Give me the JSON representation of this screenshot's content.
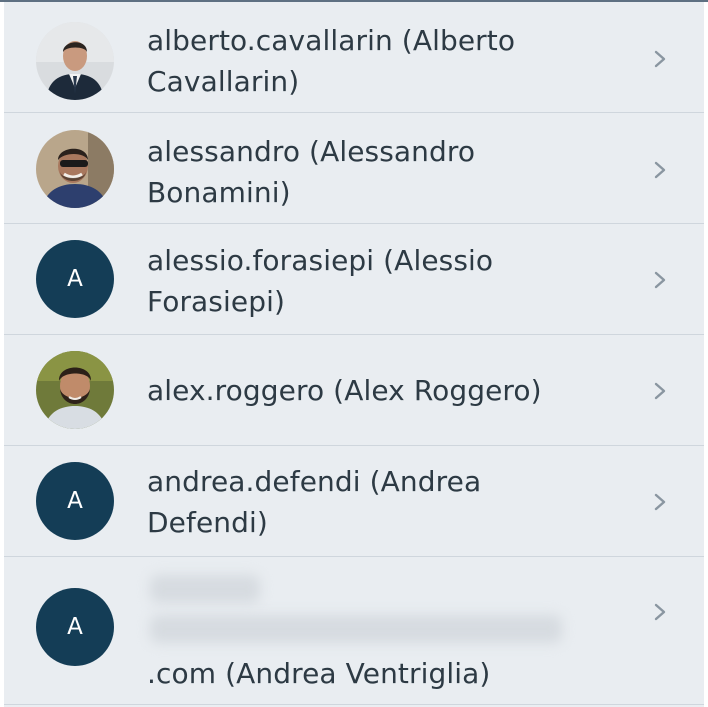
{
  "contacts": [
    {
      "label": "alberto.cavallarin (Alberto Cavallarin)",
      "avatar": "photo"
    },
    {
      "label": "alessandro (Alessandro Bonamini)",
      "avatar": "photo"
    },
    {
      "label": "alessio.forasiepi (Alessio Forasiepi)",
      "avatar": "letter",
      "initial": "A"
    },
    {
      "label": "alex.roggero (Alex Roggero)",
      "avatar": "photo"
    },
    {
      "label": "andrea.defendi (Andrea Defendi)",
      "avatar": "letter",
      "initial": "A"
    },
    {
      "label": ".com (Andrea Ventriglia)",
      "avatar": "letter",
      "initial": "A"
    }
  ],
  "icons": {
    "row_action": "chevron-right-icon"
  },
  "colors": {
    "background": "#eaeef2",
    "avatar_fill": "#143d56",
    "text": "#2d3a44",
    "chevron": "#8a96a1",
    "divider": "#cfd6dd"
  }
}
